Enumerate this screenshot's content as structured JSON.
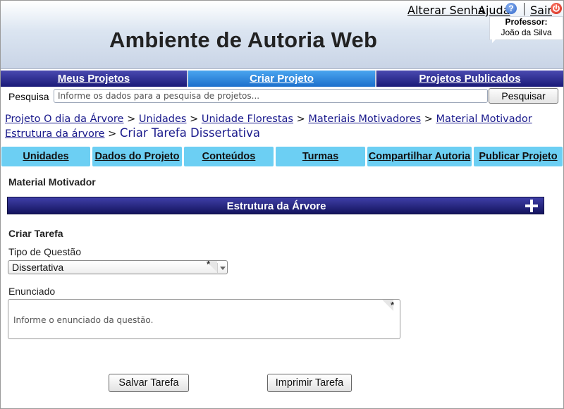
{
  "app": {
    "title": "Ambiente de Autoria Web"
  },
  "top_links": {
    "change_password": "Alterar Senha",
    "help": "Ajuda",
    "help_icon": "question-circle-icon",
    "logout": "Sair",
    "logout_icon": "power-icon"
  },
  "user": {
    "role": "Professor:",
    "name": "João da Silva"
  },
  "main_nav": {
    "items": [
      {
        "label": "Meus Projetos",
        "active": false
      },
      {
        "label": "Criar Projeto",
        "active": true
      },
      {
        "label": "Projetos Publicados",
        "active": false
      }
    ]
  },
  "search": {
    "label": "Pesquisa",
    "placeholder": "Informe os dados para a pesquisa de projetos...",
    "button": "Pesquisar"
  },
  "breadcrumb": {
    "items": [
      "Projeto O dia da Árvore",
      "Unidades",
      "Unidade Florestas",
      "Materiais Motivadores",
      "Material Motivador Estrutura da árvore"
    ],
    "separator": ">",
    "current": "Criar Tarefa Dissertativa"
  },
  "sub_tabs": {
    "items": [
      "Unidades",
      "Dados do Projeto",
      "Conteúdos",
      "Turmas",
      "Compartilhar Autoria",
      "Publicar Projeto"
    ]
  },
  "content": {
    "section_title": "Material Motivador",
    "structure_bar": {
      "title": "Estrutura da Árvore",
      "expand_icon": "plus-icon"
    },
    "form_title": "Criar Tarefa",
    "question_type": {
      "label": "Tipo de Questão",
      "value": "Dissertativa",
      "required_mark": "*"
    },
    "statement": {
      "label": "Enunciado",
      "placeholder": "Informe o enunciado da questão.",
      "required_mark": "*"
    },
    "actions": {
      "save": "Salvar Tarefa",
      "print": "Imprimir Tarefa"
    }
  },
  "colors": {
    "nav_dark": "#1a1a78",
    "nav_active": "#1c6fcc",
    "subtab_bg": "#6ccff3",
    "link": "#1a1a8c",
    "logout_red": "#d0271b",
    "help_blue": "#2d63c8"
  }
}
